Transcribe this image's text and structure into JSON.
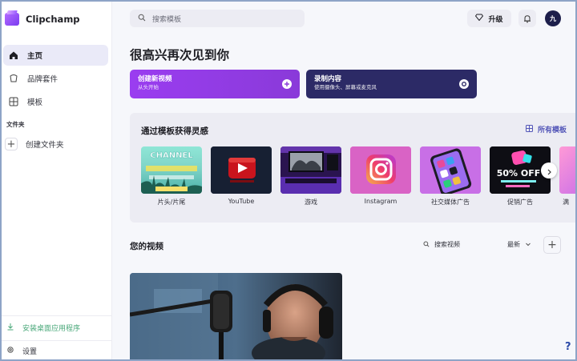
{
  "app": {
    "name": "Clipchamp"
  },
  "sidebar": {
    "items": [
      {
        "label": "主页",
        "icon": "home-icon",
        "active": true
      },
      {
        "label": "品牌套件",
        "icon": "brand-kit-icon",
        "active": false
      },
      {
        "label": "模板",
        "icon": "templates-icon",
        "active": false
      }
    ],
    "folders_label": "文件夹",
    "new_folder_label": "创建文件夹",
    "install_label": "安装桌面应用程序",
    "settings_label": "设置"
  },
  "topbar": {
    "search_placeholder": "搜索模板",
    "upgrade_label": "升级",
    "avatar_initial": "九"
  },
  "greeting": "很高兴再次见到你",
  "actions": [
    {
      "title": "创建新视频",
      "subtitle": "从头开始"
    },
    {
      "title": "录制内容",
      "subtitle": "使用摄像头、屏幕或麦克风"
    }
  ],
  "templates": {
    "title": "通过模板获得灵感",
    "all_label": "所有模板",
    "tiles": [
      {
        "label": "片头/片尾",
        "thumb_text": "CHANNEL"
      },
      {
        "label": "YouTube"
      },
      {
        "label": "游戏"
      },
      {
        "label": "Instagram"
      },
      {
        "label": "社交媒体广告"
      },
      {
        "label": "促销广告",
        "thumb_text": "50% OFF"
      },
      {
        "label": "满"
      }
    ]
  },
  "videos": {
    "title": "您的视频",
    "search_placeholder": "搜索视频",
    "sort_label": "最新"
  },
  "colors": {
    "accent": "#5356b8",
    "create_card": "#9a3df0",
    "record_card": "#2c2a66",
    "install_text": "#4aa87a"
  }
}
